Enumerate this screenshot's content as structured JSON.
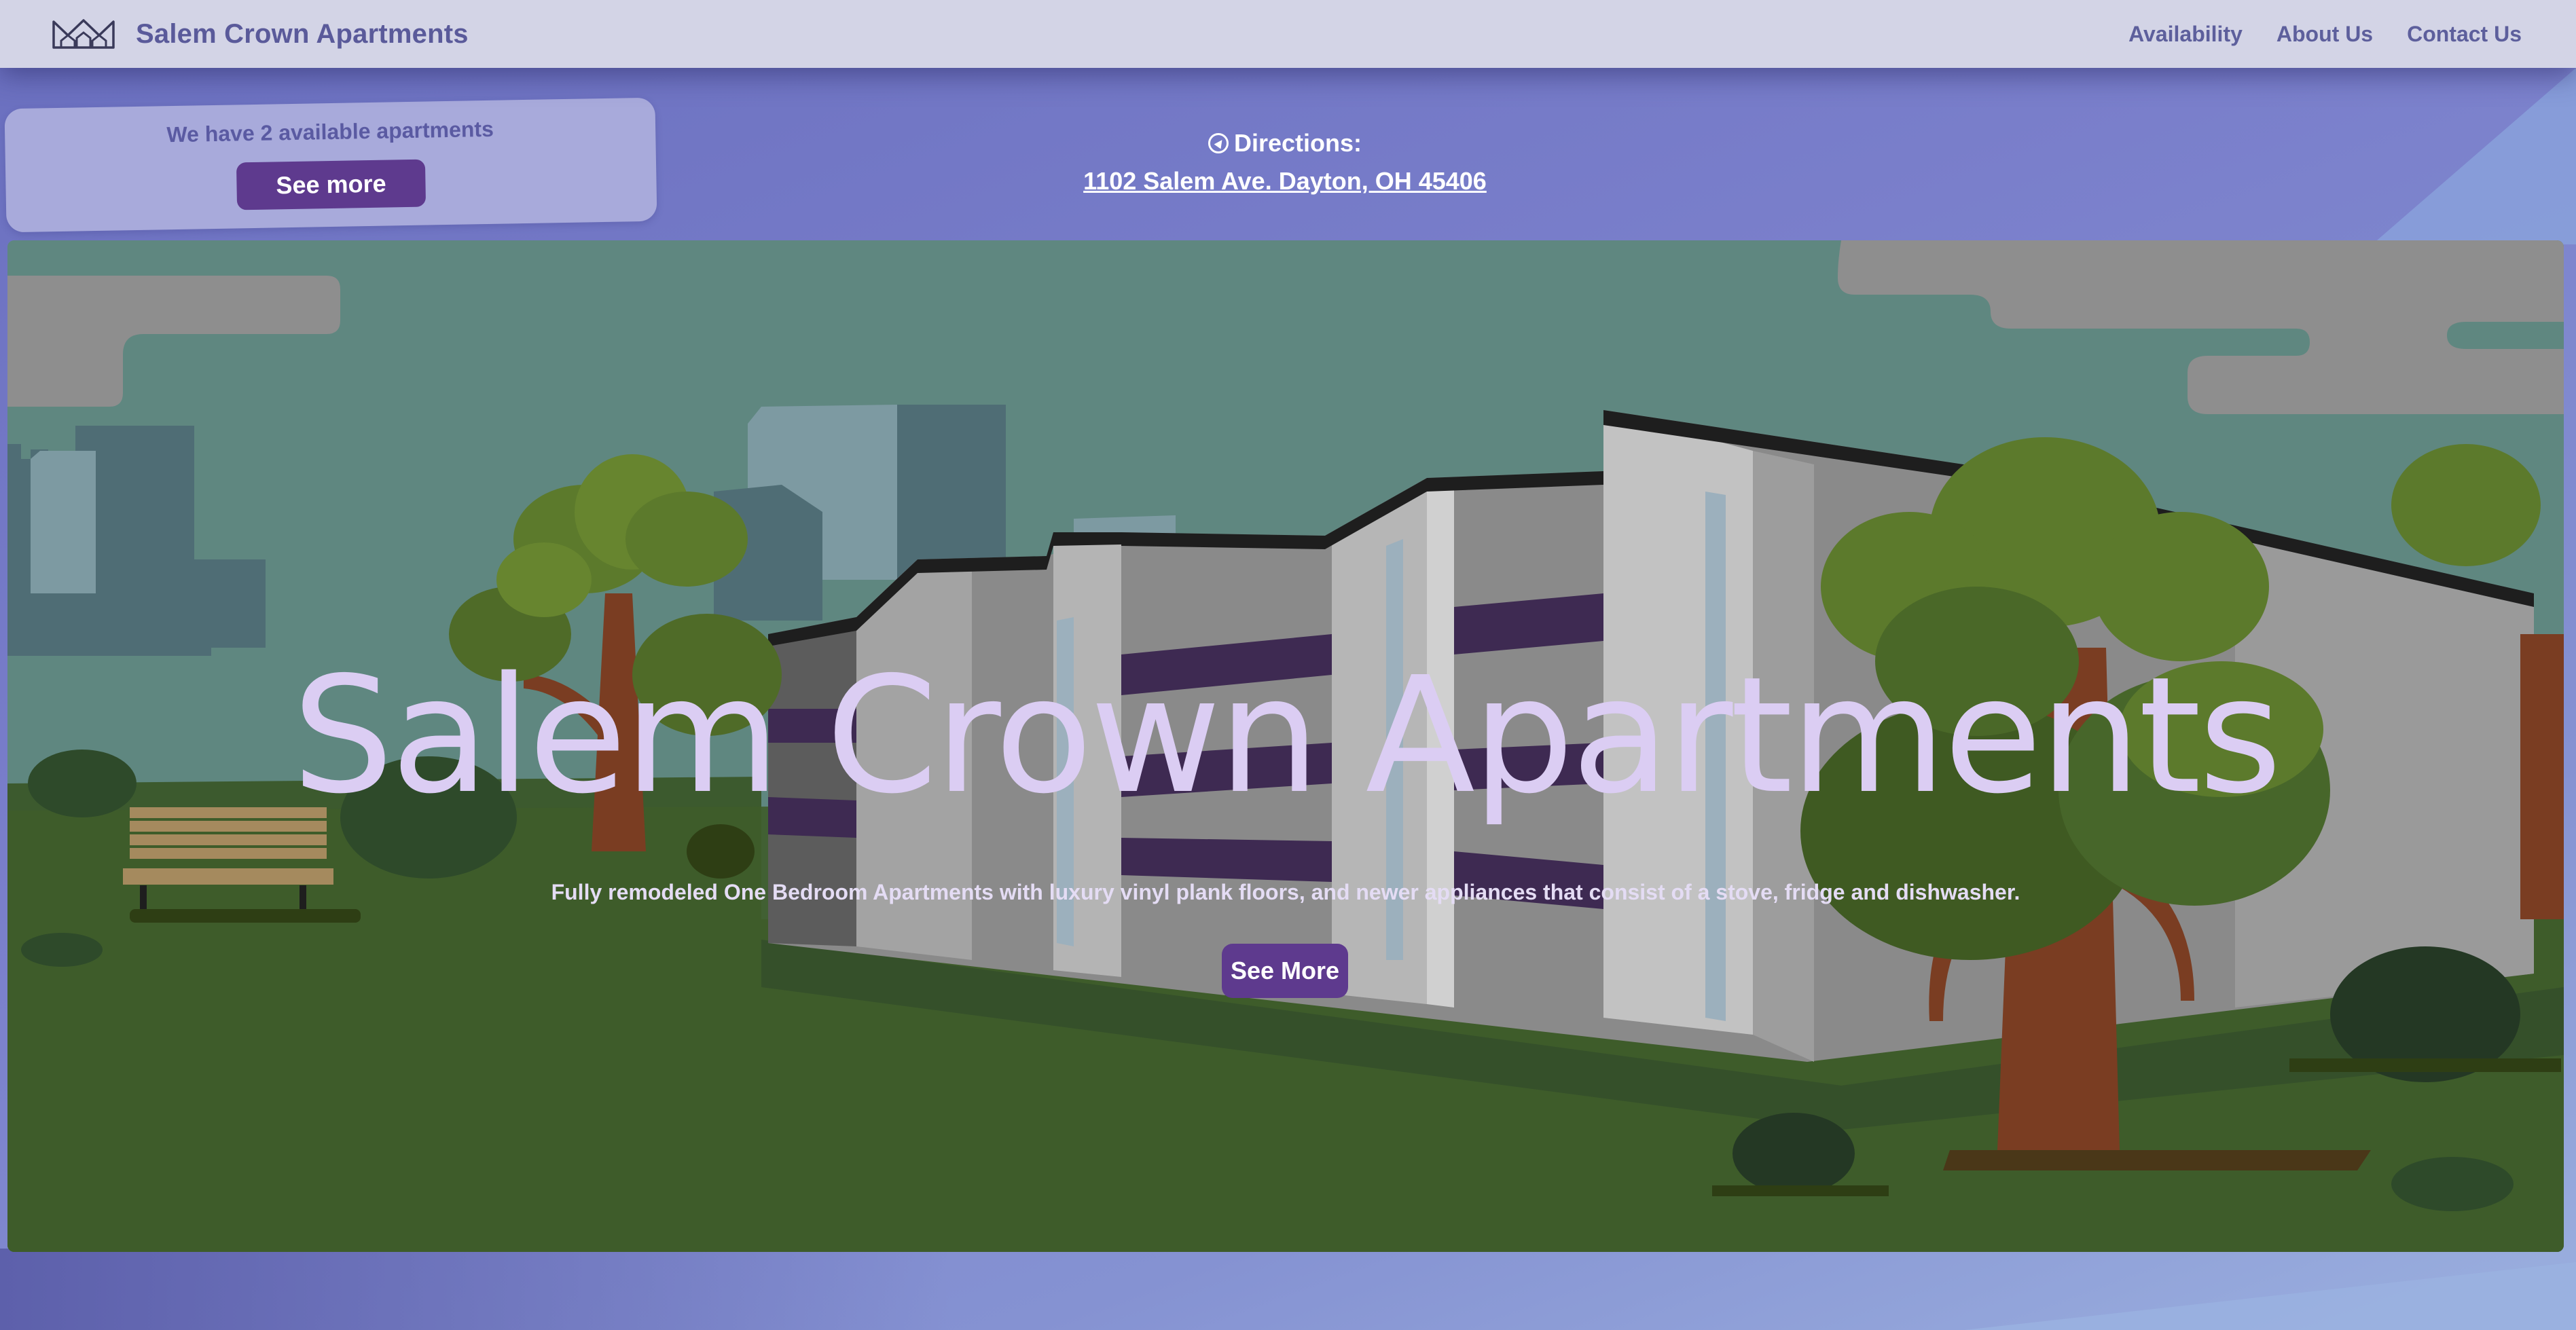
{
  "navbar": {
    "brand_name": "Salem Crown Apartments",
    "logo_icon": "crown-icon",
    "links": [
      "Availability",
      "About Us",
      "Contact Us"
    ]
  },
  "availability": {
    "text": "We have 2 available apartments",
    "button_label": "See more"
  },
  "directions": {
    "icon": "compass-icon",
    "heading": "Directions:",
    "address": "1102 Salem Ave. Dayton, OH 45406"
  },
  "hero": {
    "title": "Salem Crown Apartments",
    "subtitle": "Fully remodeled One Bedroom Apartments with luxury vinyl plank floors, and newer appliances that consist of a stove, fridge and dishwasher.",
    "button_label": "See More"
  },
  "colors": {
    "nav_bg": "#d3d4e6",
    "brand_text": "#5a5a9a",
    "button_purple": "#5e3a8e",
    "hero_title": "#dbcdf3",
    "page_bg": "#7a7fcb"
  }
}
